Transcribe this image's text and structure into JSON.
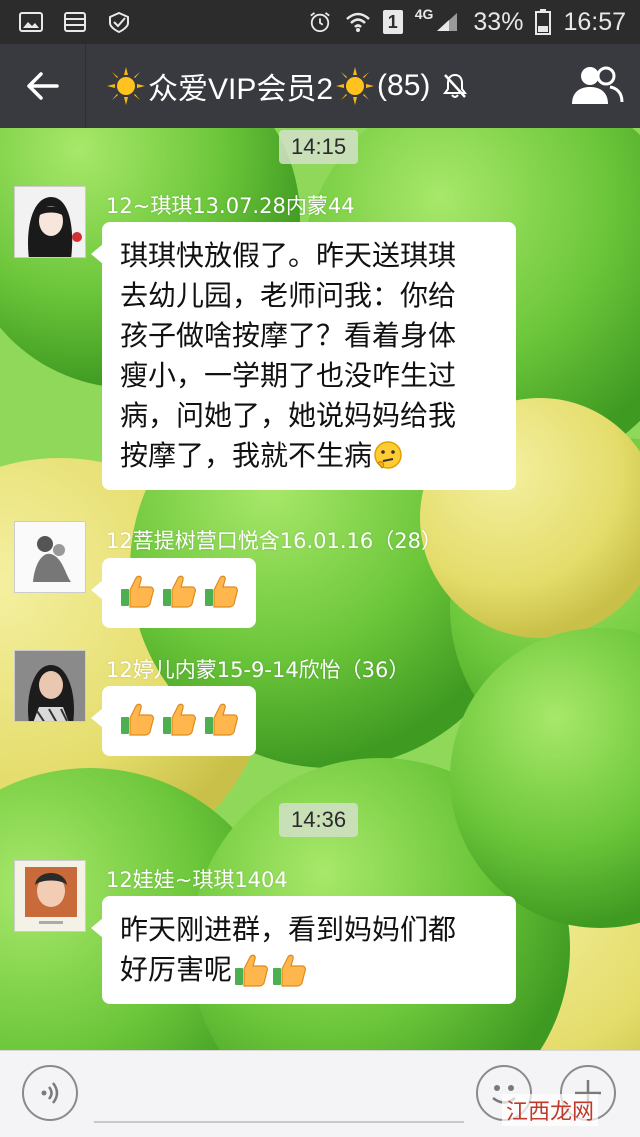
{
  "status_bar": {
    "lte_badge": "4G",
    "sim_badge": "1",
    "battery": "33%",
    "time": "16:57",
    "icons": [
      "gallery-icon",
      "storage-icon",
      "check-shield-icon",
      "alarm-icon",
      "wifi-icon",
      "sim-icon",
      "signal-icon",
      "battery-icon"
    ]
  },
  "header": {
    "title": "众爱VIP会员2",
    "member_count": "(85)",
    "icons": [
      "back-arrow-icon",
      "sun-emoji-icon",
      "mute-bell-icon",
      "group-members-icon"
    ]
  },
  "messages": {
    "time1": "14:15",
    "m1": {
      "sender": "12~琪琪13.07.28内蒙44",
      "lines": [
        "琪琪快放假了。昨天送琪琪",
        "去幼儿园，老师问我：你给",
        "孩子做啥按摩了？看着身体",
        "瘦小，一学期了也没咋生过",
        "病，问她了，她说妈妈给我",
        "按摩了，我就不生病"
      ]
    },
    "m2": {
      "sender": "12菩提树营口悦含16.01.16（28）"
    },
    "m3": {
      "sender": "12婷儿内蒙15-9-14欣怡（36）"
    },
    "time2": "14:36",
    "m4": {
      "sender": "12娃娃~琪琪1404",
      "lines": [
        "昨天刚进群，看到妈妈们都",
        "好厉害呢"
      ]
    }
  },
  "watermark": "江西龙网",
  "colors": {
    "title_bar": "#393a3f",
    "status_bar": "#2c2c2c",
    "chat_bg_green": "#6fc43a",
    "bubble": "#ffffff"
  }
}
